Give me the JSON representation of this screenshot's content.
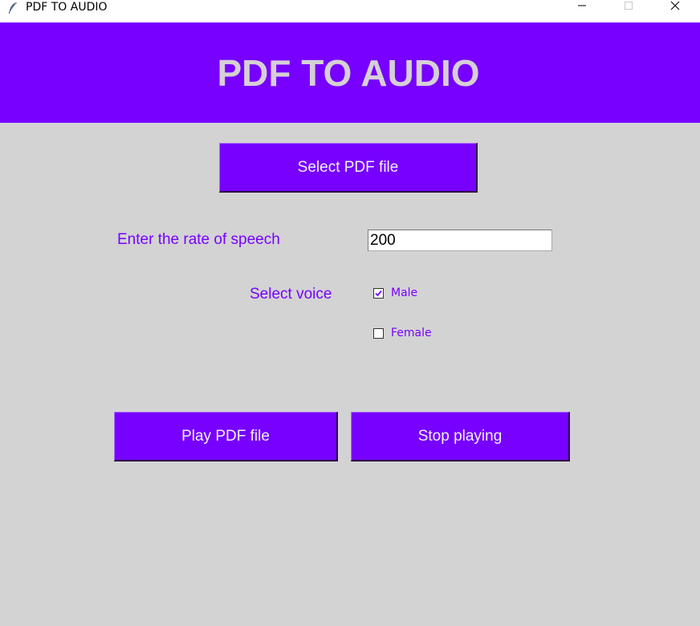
{
  "window": {
    "title": "PDF TO AUDIO",
    "app_icon": "feather-icon",
    "controls": [
      "minimize-icon",
      "maximize-icon",
      "close-icon"
    ]
  },
  "header": {
    "title": "PDF TO AUDIO"
  },
  "buttons": {
    "select_pdf": "Select PDF file",
    "play_pdf": "Play PDF file",
    "stop_playing": "Stop playing"
  },
  "rate": {
    "label": "Enter the rate of speech",
    "value": "200"
  },
  "voice": {
    "label": "Select voice",
    "options": [
      {
        "label": "Male",
        "checked": true
      },
      {
        "label": "Female",
        "checked": false
      }
    ]
  },
  "colors": {
    "accent": "#7700ff",
    "background": "#d3d3d3",
    "banner_text": "#d6d0d6",
    "button_text": "#f2f2f2"
  }
}
